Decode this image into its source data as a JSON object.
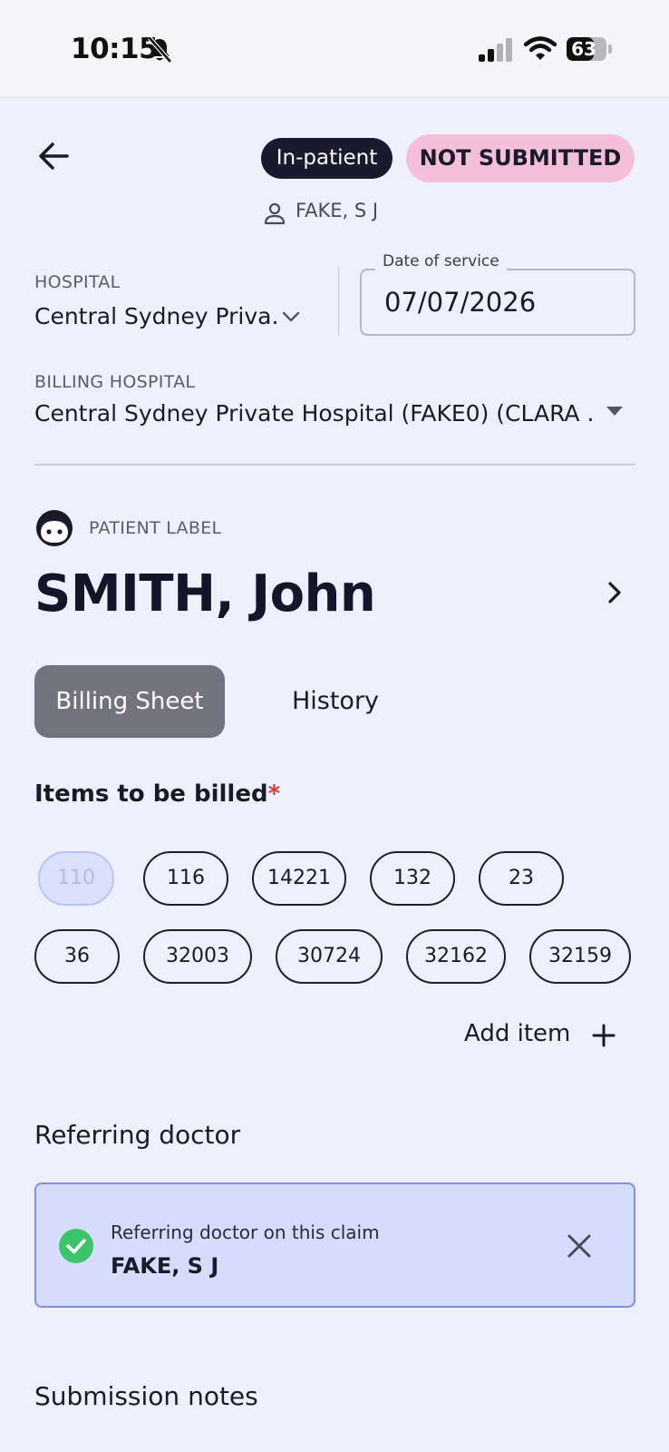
{
  "status_bar": {
    "time": "10:15",
    "battery": "63"
  },
  "header": {
    "encounter_type": "In-patient",
    "claim_status": "NOT SUBMITTED",
    "doctor": "FAKE, S J"
  },
  "hospital": {
    "label": "HOSPITAL",
    "value": "Central Sydney Priva..."
  },
  "date_of_service": {
    "label": "Date of service",
    "value": "07/07/2026"
  },
  "billing_hospital": {
    "label": "BILLING HOSPITAL",
    "value": "Central Sydney Private Hospital (FAKE0) (CLARA ..."
  },
  "patient": {
    "label": "PATIENT LABEL",
    "name": "SMITH, John"
  },
  "tabs": {
    "billing_sheet": "Billing Sheet",
    "history": "History"
  },
  "items": {
    "heading": "Items to be billed",
    "required_marker": "*",
    "chips": [
      "110",
      "116",
      "14221",
      "132",
      "23",
      "36",
      "32003",
      "30724",
      "32162",
      "32159"
    ],
    "add_label": "Add item"
  },
  "referring_doctor": {
    "heading": "Referring doctor",
    "card_label": "Referring doctor on this claim",
    "card_name": "FAKE, S J"
  },
  "submission_notes": {
    "heading": "Submission notes"
  },
  "colors": {
    "background": "#eff0fe",
    "status_pill": "#f4bfdb",
    "inpatient_pill": "#1a1a2e",
    "active_tab": "#73737f",
    "referral_card": "#d6dcfb",
    "check_green": "#3cc46a",
    "required_red": "#e0383a"
  }
}
